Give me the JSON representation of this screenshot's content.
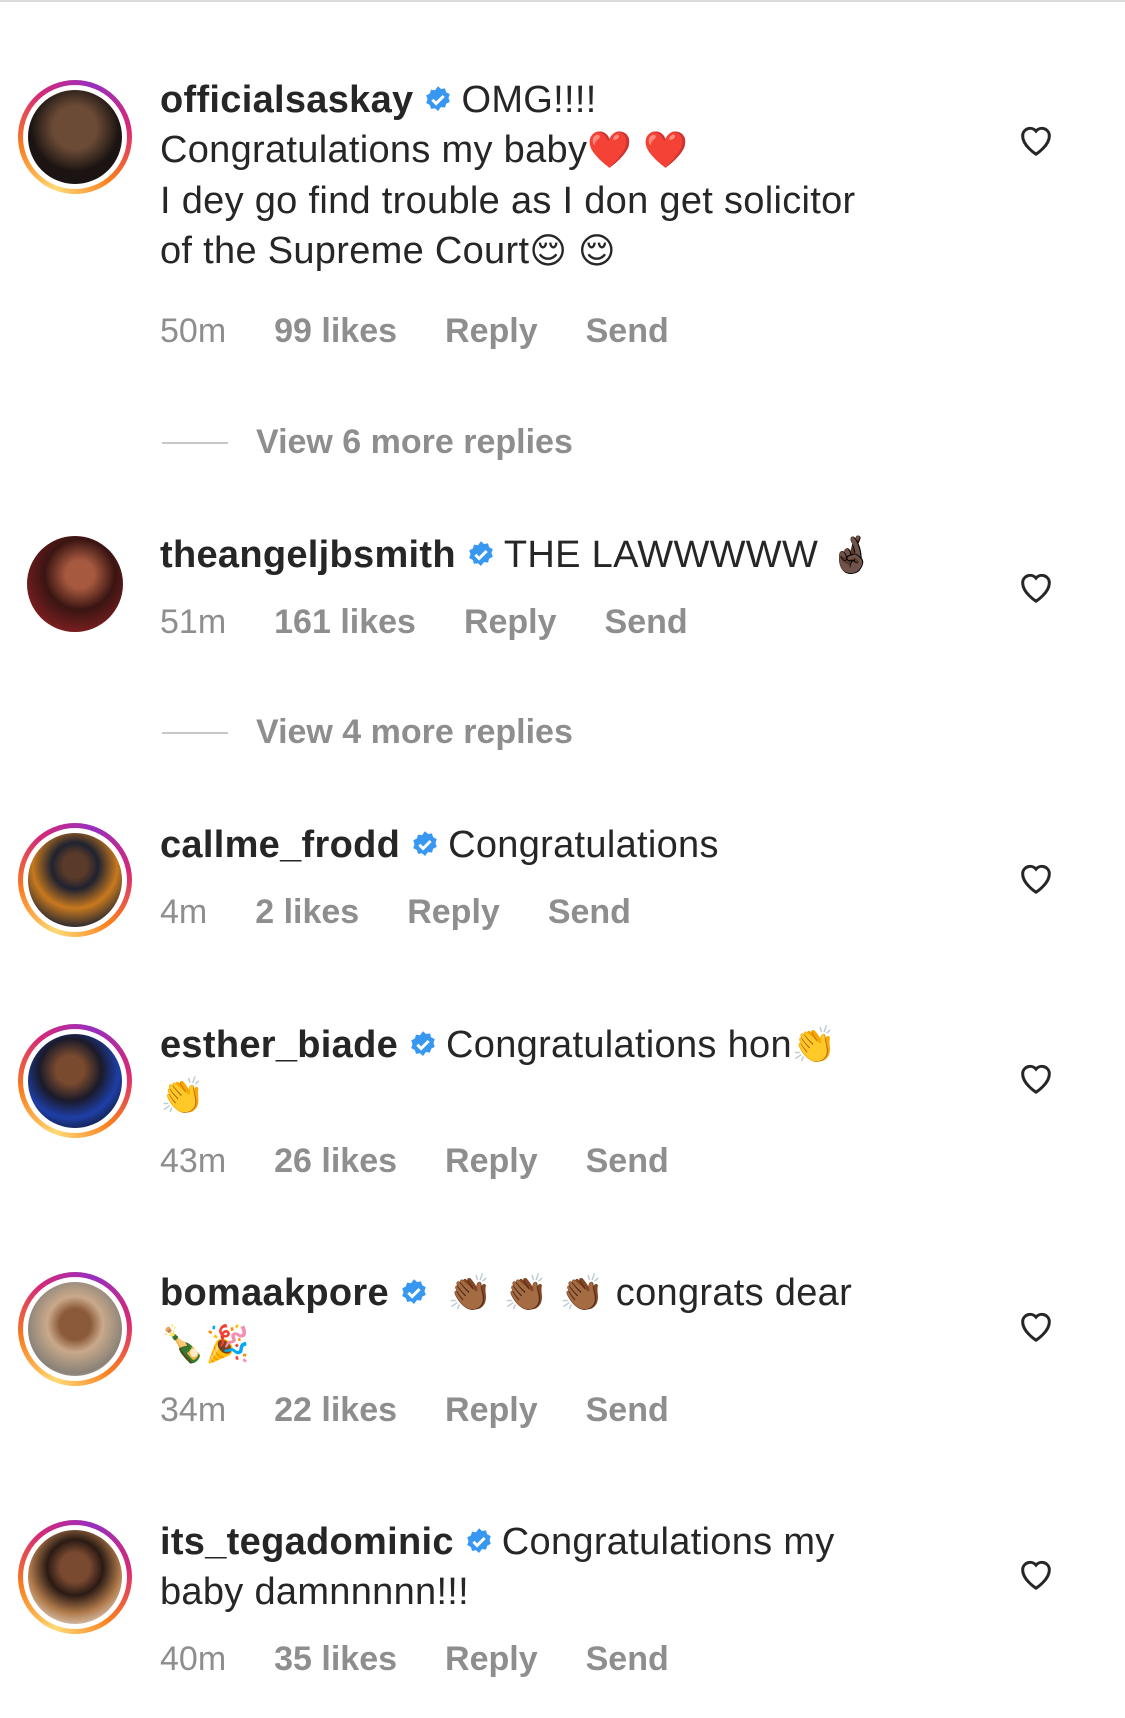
{
  "comments": [
    {
      "username": "officialsaskay",
      "text_lines": [
        "OMG!!!!",
        "Congratulations my baby",
        "I dey go find trouble as I don get solicitor",
        "of the Supreme Court"
      ],
      "emojis": [
        "❤️",
        "❤️",
        "😌",
        "😌"
      ],
      "time": "50m",
      "likes": "99 likes",
      "reply": "Reply",
      "send": "Send",
      "view_replies": "View 6 more replies"
    },
    {
      "username": "theangeljbsmith",
      "text_lines": [
        "THE LAWWWWW"
      ],
      "emojis": [
        "🤞🏿"
      ],
      "time": "51m",
      "likes": "161 likes",
      "reply": "Reply",
      "send": "Send",
      "view_replies": "View 4 more replies"
    },
    {
      "username": "callme_frodd",
      "text_lines": [
        "Congratulations"
      ],
      "time": "4m",
      "likes": "2 likes",
      "reply": "Reply",
      "send": "Send"
    },
    {
      "username": "esther_biade",
      "text_lines": [
        "Congratulations hon"
      ],
      "emojis": [
        "👏",
        "👏"
      ],
      "time": "43m",
      "likes": "26 likes",
      "reply": "Reply",
      "send": "Send"
    },
    {
      "username": "bomaakpore",
      "text_lines": [
        "congrats dear"
      ],
      "emojis": [
        "👏🏾",
        "👏🏾",
        "👏🏾",
        "🍾",
        "🎉"
      ],
      "time": "34m",
      "likes": "22 likes",
      "reply": "Reply",
      "send": "Send"
    },
    {
      "username": "its_tegadominic",
      "text_lines": [
        "Congratulations my",
        "baby damnnnnn!!!"
      ],
      "time": "40m",
      "likes": "35 likes",
      "reply": "Reply",
      "send": "Send"
    }
  ],
  "colors": {
    "text": "#262626",
    "meta": "#8e8e8e",
    "verified": "#3897f0",
    "ring_start": "#feda75",
    "ring_end": "#d62976"
  },
  "icons": [
    "verified-badge-icon",
    "heart-icon"
  ]
}
